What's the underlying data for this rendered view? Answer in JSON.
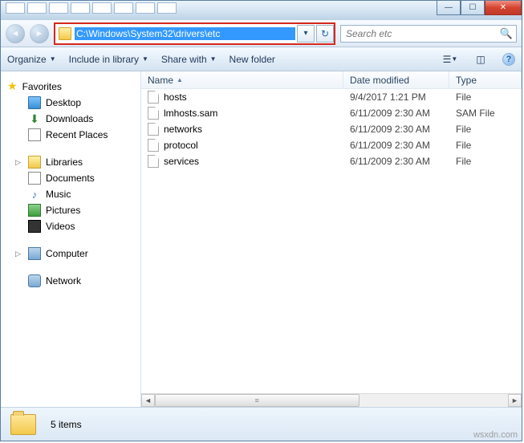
{
  "address": {
    "path": "C:\\Windows\\System32\\drivers\\etc"
  },
  "search": {
    "placeholder": "Search etc"
  },
  "toolbar": {
    "organize": "Organize",
    "include": "Include in library",
    "share": "Share with",
    "newfolder": "New folder"
  },
  "sidebar": {
    "favorites": "Favorites",
    "desktop": "Desktop",
    "downloads": "Downloads",
    "recent": "Recent Places",
    "libraries": "Libraries",
    "documents": "Documents",
    "music": "Music",
    "pictures": "Pictures",
    "videos": "Videos",
    "computer": "Computer",
    "network": "Network"
  },
  "columns": {
    "name": "Name",
    "date": "Date modified",
    "type": "Type"
  },
  "files": [
    {
      "name": "hosts",
      "date": "9/4/2017 1:21 PM",
      "type": "File"
    },
    {
      "name": "lmhosts.sam",
      "date": "6/11/2009 2:30 AM",
      "type": "SAM File"
    },
    {
      "name": "networks",
      "date": "6/11/2009 2:30 AM",
      "type": "File"
    },
    {
      "name": "protocol",
      "date": "6/11/2009 2:30 AM",
      "type": "File"
    },
    {
      "name": "services",
      "date": "6/11/2009 2:30 AM",
      "type": "File"
    }
  ],
  "status": {
    "count": "5 items"
  },
  "watermark": "wsxdn.com"
}
